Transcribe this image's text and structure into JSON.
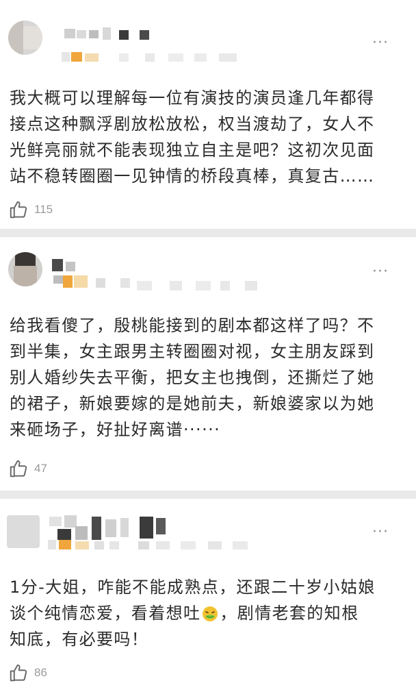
{
  "comments": [
    {
      "more": "···",
      "lines": [
        "我大概可以理解每一位有演技的演员逢几年都得",
        "接点这种飘浮剧放松放松，权当渡劫了，女人不",
        "光鲜亮丽就不能表现独立自主是吧？这初次见面",
        "站不稳转圈圈一见钟情的桥段真棒，真复古……"
      ],
      "likes": "115"
    },
    {
      "more": "···",
      "lines": [
        "给我看傻了，殷桃能接到的剧本都这样了吗？不",
        "到半集，女主跟男主转圈圈对视，女主朋友踩到",
        "别人婚纱失去平衡，把女主也拽倒，还撕烂了她",
        "的裙子，新娘要嫁的是她前夫，新娘婆家以为她",
        "来砸场子，好扯好离谱······"
      ],
      "likes": "47"
    },
    {
      "more": "···",
      "lines_pre": "1分-大姐，咋能不能成熟点，还跟二十岁小姑娘",
      "line2_a": "谈个纯情恋爱，看着想吐",
      "line2_emoji": "nauseated-face-icon",
      "line2_b": "，剧情老套的知根",
      "line3": "知底，有必要吗！",
      "likes": "86"
    }
  ],
  "colors": {
    "background": "#e9e9e9",
    "card": "#ffffff",
    "text": "#2b2b2b",
    "meta": "#9a9a9a",
    "badge_orange": "#f0a63c"
  }
}
